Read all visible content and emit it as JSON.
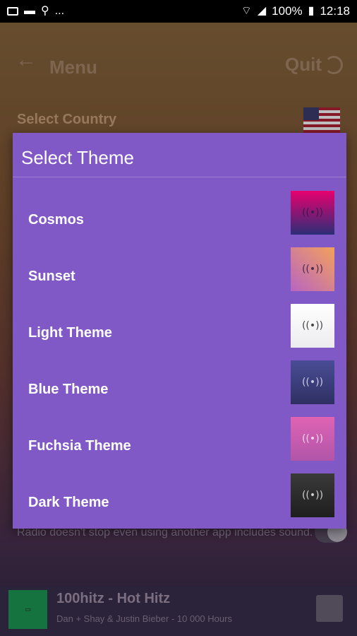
{
  "status_bar": {
    "battery": "100%",
    "time": "12:18",
    "dots": "..."
  },
  "toolbar": {
    "title": "Menu",
    "quit_label": "Quit"
  },
  "settings": {
    "country_label": "Select Country",
    "background_desc": "Radio doesn't stop even using another app includes sound."
  },
  "dialog": {
    "title": "Select Theme",
    "options": [
      {
        "label": "Cosmos",
        "icon": "radio-wave-icon",
        "swatch": [
          "#e8006f",
          "#2b2e78"
        ]
      },
      {
        "label": "Sunset",
        "icon": "radio-wave-icon",
        "swatch": [
          "#f3a15b",
          "#b864c3"
        ]
      },
      {
        "label": "Light Theme",
        "icon": "radio-wave-icon",
        "swatch": [
          "#ffffff",
          "#ececef"
        ]
      },
      {
        "label": "Blue Theme",
        "icon": "radio-wave-icon",
        "swatch": [
          "#4a4d96",
          "#2e3062"
        ]
      },
      {
        "label": "Fuchsia Theme",
        "icon": "radio-wave-icon",
        "swatch": [
          "#df63b3",
          "#b155a9"
        ]
      },
      {
        "label": "Dark Theme",
        "icon": "radio-wave-icon",
        "swatch": [
          "#3a3a3a",
          "#1e1e1e"
        ]
      }
    ]
  },
  "player": {
    "station": "100hitz - Hot Hitz",
    "track": "Dan + Shay & Justin Bieber - 10 000 Hours"
  },
  "radio_icon_glyph": "((•))"
}
